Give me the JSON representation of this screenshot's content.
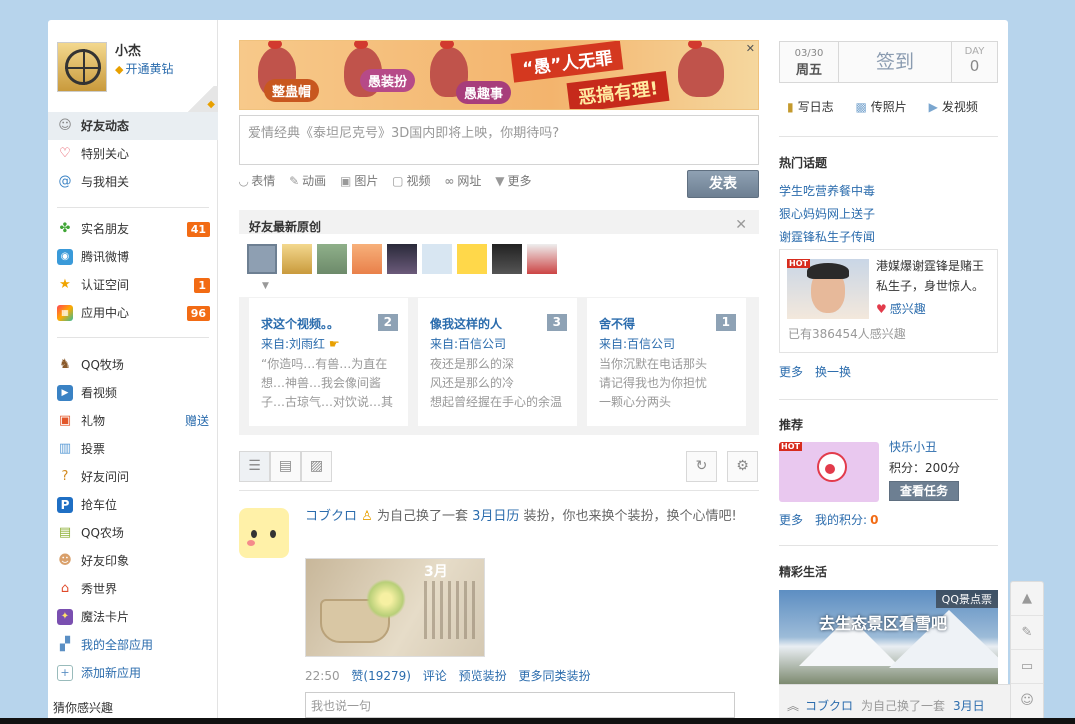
{
  "user": {
    "name": "小杰",
    "vip_link": "开通黄钻"
  },
  "nav_main": [
    {
      "label": "好友动态",
      "icon": "person-icon"
    },
    {
      "label": "特别关心",
      "icon": "heart-icon"
    },
    {
      "label": "与我相关",
      "icon": "at-icon"
    }
  ],
  "nav_social": [
    {
      "label": "实名朋友",
      "icon": "clover-icon",
      "badge": "41"
    },
    {
      "label": "腾讯微博",
      "icon": "weibo-icon",
      "badge": ""
    },
    {
      "label": "认证空间",
      "icon": "star-icon",
      "badge": "1"
    },
    {
      "label": "应用中心",
      "icon": "apps-icon",
      "badge": "96"
    }
  ],
  "nav_apps": [
    {
      "label": "QQ牧场",
      "icon": "ranch-icon"
    },
    {
      "label": "看视频",
      "icon": "video-icon"
    },
    {
      "label": "礼物",
      "icon": "gift-icon",
      "extra": "赠送"
    },
    {
      "label": "投票",
      "icon": "vote-icon"
    },
    {
      "label": "好友问问",
      "icon": "question-icon"
    },
    {
      "label": "抢车位",
      "icon": "parking-icon"
    },
    {
      "label": "QQ农场",
      "icon": "farm-icon"
    },
    {
      "label": "好友印象",
      "icon": "impression-icon"
    },
    {
      "label": "秀世界",
      "icon": "house-icon"
    },
    {
      "label": "魔法卡片",
      "icon": "magic-card-icon"
    },
    {
      "label": "我的全部应用",
      "icon": "all-apps-icon"
    },
    {
      "label": "添加新应用",
      "icon": "add-app-icon"
    }
  ],
  "guess_title": "猜你感兴趣",
  "banner": {
    "tag1": "整蛊帽",
    "tag2": "愚装扮",
    "tag3": "愚趣事",
    "slogan1": "“愚”人无罪",
    "slogan2": "恶搞有理!"
  },
  "composer": {
    "placeholder": "爱情经典《泰坦尼克号》3D国内即将上映，你期待吗?",
    "post_label": "发表",
    "tools": [
      {
        "icon": "smile-icon",
        "label": "表情"
      },
      {
        "icon": "animation-icon",
        "label": "动画"
      },
      {
        "icon": "image-icon",
        "label": "图片"
      },
      {
        "icon": "video-icon",
        "label": "视频"
      },
      {
        "icon": "link-icon",
        "label": "网址"
      },
      {
        "icon": "triangle-down-icon",
        "label": "更多"
      }
    ]
  },
  "originals": {
    "title": "好友最新原创",
    "cards": [
      {
        "title": "求这个视频。。",
        "count": "2",
        "from": "来自:刘雨红",
        "lines": [
          "“你造吗…有兽…为直在",
          "想…神兽…我会像间酱",
          "子…古琼气…对饮说…其"
        ]
      },
      {
        "title": "像我这样的人",
        "count": "3",
        "from": "来自:百信公司",
        "lines": [
          "夜还是那么的深",
          "风还是那么的冷",
          "想起曾经握在手心的余温"
        ]
      },
      {
        "title": "舍不得",
        "count": "1",
        "from": "来自:百信公司",
        "lines": [
          "当你沉默在电话那头",
          "请记得我也为你担忧",
          "一颗心分两头"
        ]
      }
    ]
  },
  "feed": {
    "name": "コブクロ",
    "text1": "为自己换了一套",
    "calendar": "3月日历",
    "text2": "装扮，你也来换个装扮，换个心情吧!",
    "image_month": "3月",
    "time": "22:50",
    "like": "赞(19279)",
    "comment": "评论",
    "preview": "预览装扮",
    "more": "更多同类装扮",
    "comment_placeholder": "我也说一句"
  },
  "checkin": {
    "date": "03/30",
    "weekday": "周五",
    "label": "签到",
    "day_label": "DAY",
    "day_value": "0"
  },
  "quick": [
    {
      "icon": "diary-icon",
      "label": "写日志"
    },
    {
      "icon": "photo-icon",
      "label": "传照片"
    },
    {
      "icon": "video-upload-icon",
      "label": "发视频"
    }
  ],
  "hot": {
    "title": "热门话题",
    "topics": [
      "学生吃营养餐中毒",
      "狠心妈妈网上送子",
      "谢霆锋私生子传闻"
    ],
    "tag": "HOT",
    "desc": "港媒爆谢霆锋是赌王私生子，身世惊人。",
    "interest": "感兴趣",
    "count": "已有386454人感兴趣",
    "more": "更多",
    "refresh": "换一换"
  },
  "recommend": {
    "title": "推荐",
    "tag": "HOT",
    "name": "快乐小丑",
    "score": "积分：200分",
    "button": "查看任务",
    "more": "更多",
    "my_score_label": "我的积分:",
    "my_score": "0"
  },
  "life": {
    "title": "精彩生活",
    "tag": "QQ景点票",
    "slogan": "去生态景区看雪吧"
  },
  "ticker": {
    "name": "コブクロ",
    "text": "为自己换了一套",
    "calendar": "3月日"
  }
}
